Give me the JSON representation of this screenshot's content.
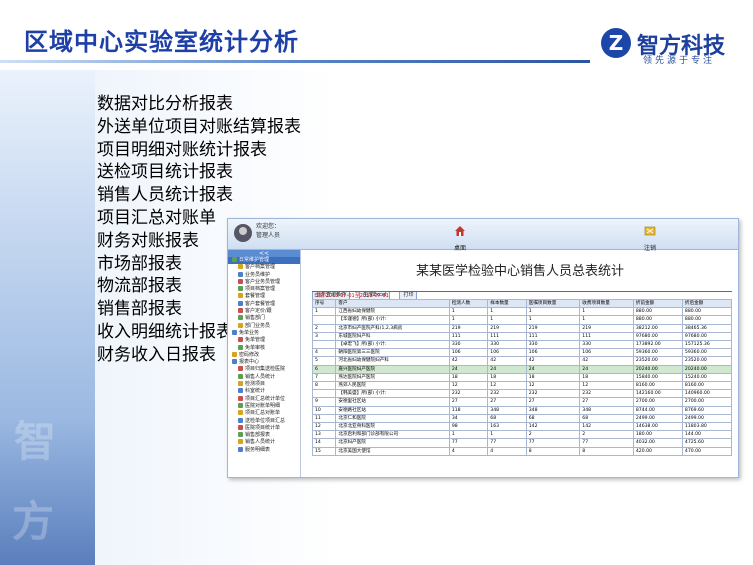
{
  "header": {
    "title": "区域中心实验室统计分析",
    "logo_mark": "Z",
    "logo_text": "智方科技",
    "logo_slogan": "领先源于专注"
  },
  "watermark": [
    "智",
    "方"
  ],
  "report_list": [
    "数据对比分析报表",
    "外送单位项目对账结算报表",
    "项目明细对账统计报表",
    "送检项目统计报表",
    "销售人员统计报表",
    "项目汇总对账单",
    "财务对账报表",
    "市场部报表",
    "物流部报表",
    "销售部报表",
    "收入明细统计报表",
    "财务收入日报表"
  ],
  "app": {
    "welcome": "欢迎您：",
    "user": "管理人员",
    "nav_home": "桌面",
    "nav_logout": "注销",
    "sidebar_collapse": "<<",
    "sidebar": [
      {
        "label": "日常维护管理",
        "selected": true
      },
      {
        "label": "客户档案管理"
      },
      {
        "label": "业务员维护"
      },
      {
        "label": "客户业务员管理"
      },
      {
        "label": "项目档案管理"
      },
      {
        "label": "套餐管理"
      },
      {
        "label": "客户套餐管理"
      },
      {
        "label": "客户定价/跟"
      },
      {
        "label": "销售部门"
      },
      {
        "label": "部门业务员"
      },
      {
        "label": "免单业务"
      },
      {
        "label": "免单管理"
      },
      {
        "label": "免单审核"
      },
      {
        "label": "密码修改"
      },
      {
        "label": "报表中心"
      },
      {
        "label": "项目归集送检医院"
      },
      {
        "label": "销售人员统计"
      },
      {
        "label": "检测项目"
      },
      {
        "label": "科室统计"
      },
      {
        "label": "项目汇总统计单位"
      },
      {
        "label": "医院对账单明细"
      },
      {
        "label": "项目汇总对账单"
      },
      {
        "label": "送检单位项目汇总"
      },
      {
        "label": "医院项目统计单"
      },
      {
        "label": "销售部报表"
      },
      {
        "label": "销售人员统计"
      },
      {
        "label": "服务明细表"
      }
    ],
    "report_title": "某某医学检验中心销售人员总表统计",
    "toolbar": [
      "显示查询条件",
      "生成Excel",
      "打印"
    ],
    "date_range": "日期:2013-07-01至2013-07-31",
    "table": {
      "headers": [
        "序号",
        "客户",
        "检测人数",
        "样本数量",
        "医嘱项目数量",
        "收费项目数量",
        "折前金额",
        "折后金额"
      ],
      "rows": [
        [
          "1",
          "江西省妇幼保健院",
          "1",
          "1",
          "1",
          "1",
          "880.00",
          "880.00"
        ],
        [
          "",
          "【华谨德】所(部) 小计:",
          "1",
          "1",
          "1",
          "1",
          "880.00",
          "880.00"
        ],
        [
          "2",
          "北京市妇产医院产科(1,2,3病房",
          "219",
          "219",
          "219",
          "219",
          "38212.00",
          "38465.36"
        ],
        [
          "3",
          "东城医院妇产科",
          "111",
          "111",
          "111",
          "111",
          "97680.00",
          "97680.00"
        ],
        [
          "",
          "【卓宏飞】所(部) 小计:",
          "330",
          "330",
          "330",
          "330",
          "173892.00",
          "157125.36"
        ],
        [
          "4",
          "朝阳医院第三三医院",
          "106",
          "106",
          "106",
          "106",
          "59360.00",
          "59360.00"
        ],
        [
          "5",
          "河北省妇幼保健院妇产科",
          "42",
          "42",
          "42",
          "42",
          "23520.00",
          "23520.00"
        ],
        [
          "6",
          "嘉兴医院妇产医院",
          "24",
          "24",
          "24",
          "24",
          "20240.00",
          "20240.00"
        ],
        [
          "7",
          "燕达医院妇产医院",
          "18",
          "18",
          "18",
          "18",
          "15840.00",
          "15240.00"
        ],
        [
          "8",
          "燕郊人民医院",
          "12",
          "12",
          "12",
          "12",
          "8160.00",
          "8160.00"
        ],
        [
          "",
          "【韩美盛】所(部) 小计:",
          "232",
          "232",
          "232",
          "232",
          "142160.00",
          "140960.00"
        ],
        [
          "9",
          "安德里社区站",
          "27",
          "27",
          "27",
          "27",
          "2700.00",
          "2700.00"
        ],
        [
          "10",
          "安德路社区站",
          "118",
          "348",
          "348",
          "348",
          "8744.00",
          "8769.60"
        ],
        [
          "11",
          "北京仁和医院",
          "34",
          "68",
          "68",
          "68",
          "2499.00",
          "2499.00"
        ],
        [
          "12",
          "北京北亚骨科医院",
          "98",
          "163",
          "142",
          "142",
          "14638.00",
          "11803.80"
        ],
        [
          "13",
          "北京启利和部门诊部有限公司",
          "1",
          "1",
          "2",
          "2",
          "180.00",
          "144.00"
        ],
        [
          "14",
          "北京妇产医院",
          "77",
          "77",
          "77",
          "77",
          "4032.00",
          "4725.60"
        ],
        [
          "15",
          "北京美国大使馆",
          "4",
          "4",
          "8",
          "8",
          "420.00",
          "470.00"
        ]
      ]
    }
  },
  "colors": {
    "title": "#1d3fa8",
    "logo": "#1c46a8",
    "sidebar_selected": "#3d6fbf",
    "highlight_row": "#cfe8cf"
  }
}
